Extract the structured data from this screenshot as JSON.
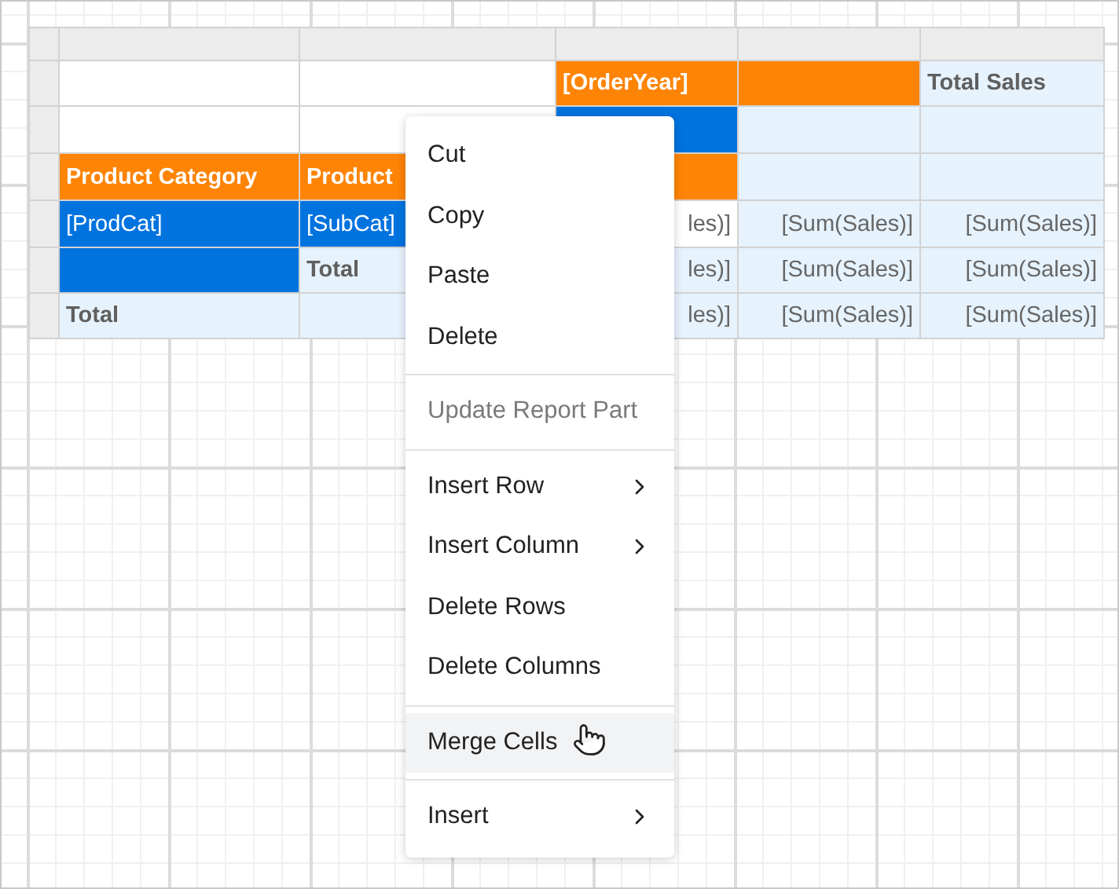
{
  "table": {
    "rows": [
      {
        "cells": [
          {
            "kind": "blank",
            "text": ""
          },
          {
            "kind": "blank",
            "text": ""
          },
          {
            "kind": "header",
            "text": "[OrderYear]"
          },
          {
            "kind": "header",
            "text": ""
          },
          {
            "kind": "total",
            "text": "Total Sales"
          }
        ]
      },
      {
        "cells": [
          {
            "kind": "blank",
            "text": ""
          },
          {
            "kind": "blank",
            "text": ""
          },
          {
            "kind": "field",
            "text": ""
          },
          {
            "kind": "value",
            "text": ""
          },
          {
            "kind": "value",
            "text": ""
          }
        ]
      },
      {
        "cells": [
          {
            "kind": "header",
            "text": "Product Category"
          },
          {
            "kind": "header",
            "text": "Product"
          },
          {
            "kind": "header",
            "text": ""
          },
          {
            "kind": "value",
            "text": ""
          },
          {
            "kind": "value",
            "text": ""
          }
        ]
      },
      {
        "cells": [
          {
            "kind": "field",
            "text": "[ProdCat]"
          },
          {
            "kind": "field",
            "text": "[SubCat]"
          },
          {
            "kind": "blank",
            "text": "les)]"
          },
          {
            "kind": "value",
            "text": "[Sum(Sales)]"
          },
          {
            "kind": "value",
            "text": "[Sum(Sales)]"
          }
        ]
      },
      {
        "cells": [
          {
            "kind": "field",
            "text": ""
          },
          {
            "kind": "total",
            "text": "Total"
          },
          {
            "kind": "value",
            "text": "les)]"
          },
          {
            "kind": "value",
            "text": "[Sum(Sales)]"
          },
          {
            "kind": "value",
            "text": "[Sum(Sales)]"
          }
        ]
      },
      {
        "cells": [
          {
            "kind": "total",
            "text": "Total"
          },
          {
            "kind": "value",
            "text": ""
          },
          {
            "kind": "value",
            "text": "les)]"
          },
          {
            "kind": "value",
            "text": "[Sum(Sales)]"
          },
          {
            "kind": "value",
            "text": "[Sum(Sales)]"
          }
        ]
      }
    ]
  },
  "context_menu": {
    "items": [
      {
        "kind": "item",
        "label": "Cut",
        "disabled": false,
        "hovered": false,
        "submenu": false
      },
      {
        "kind": "item",
        "label": "Copy",
        "disabled": false,
        "hovered": false,
        "submenu": false
      },
      {
        "kind": "item",
        "label": "Paste",
        "disabled": false,
        "hovered": false,
        "submenu": false
      },
      {
        "kind": "item",
        "label": "Delete",
        "disabled": false,
        "hovered": false,
        "submenu": false
      },
      {
        "kind": "separator"
      },
      {
        "kind": "item",
        "label": "Update Report Part",
        "disabled": true,
        "hovered": false,
        "submenu": false
      },
      {
        "kind": "separator"
      },
      {
        "kind": "item",
        "label": "Insert Row",
        "disabled": false,
        "hovered": false,
        "submenu": true
      },
      {
        "kind": "item",
        "label": "Insert Column",
        "disabled": false,
        "hovered": false,
        "submenu": true
      },
      {
        "kind": "item",
        "label": "Delete Rows",
        "disabled": false,
        "hovered": false,
        "submenu": false
      },
      {
        "kind": "item",
        "label": "Delete Columns",
        "disabled": false,
        "hovered": false,
        "submenu": false
      },
      {
        "kind": "separator"
      },
      {
        "kind": "item",
        "label": "Merge Cells",
        "disabled": false,
        "hovered": true,
        "submenu": false
      },
      {
        "kind": "separator"
      },
      {
        "kind": "item",
        "label": "Insert",
        "disabled": false,
        "hovered": false,
        "submenu": true
      }
    ]
  }
}
